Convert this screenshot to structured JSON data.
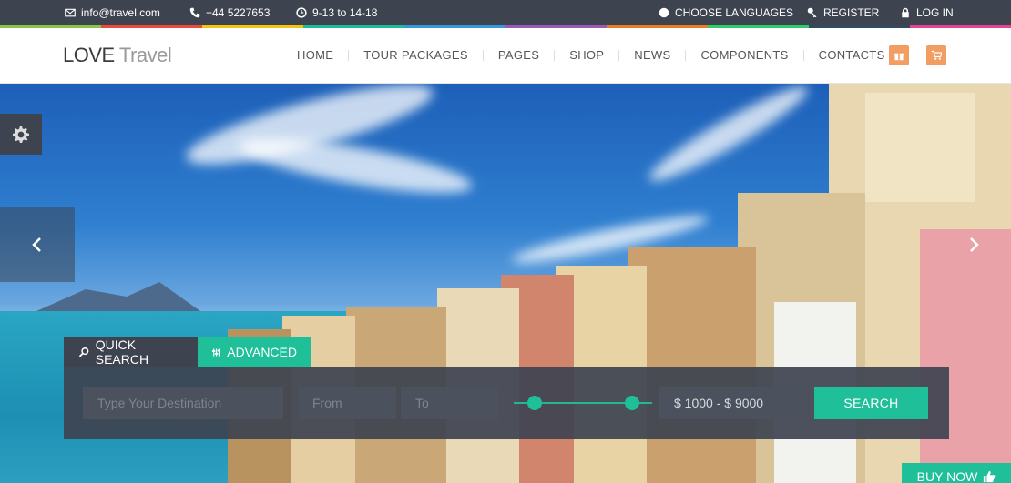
{
  "topbar": {
    "email": "info@travel.com",
    "phone": "+44 5227653",
    "hours": "9-13 to 14-18",
    "languages": "CHOOSE LANGUAGES",
    "register": "REGISTER",
    "login": "LOG IN"
  },
  "strip_colors": [
    "#8bc34a",
    "#e74c3c",
    "#f1c40f",
    "#1abc9c",
    "#3498db",
    "#9b59b6",
    "#e67e22",
    "#2ecc71",
    "#34495e",
    "#e84393"
  ],
  "logo": {
    "bold": "LOVE",
    "light": "Travel"
  },
  "nav": [
    "HOME",
    "TOUR PACKAGES",
    "PAGES",
    "SHOP",
    "NEWS",
    "COMPONENTS",
    "CONTACTS"
  ],
  "header_icons": [
    "gift-icon",
    "cart-icon"
  ],
  "accent": "#1fbf9a",
  "search": {
    "tab_quick": "QUICK SEARCH",
    "tab_advanced": "ADVANCED",
    "destination_placeholder": "Type Your Destination",
    "from_placeholder": "From",
    "to_placeholder": "To",
    "price_range": "$ 1000 - $ 9000",
    "button": "SEARCH"
  },
  "buy_now": "BUY NOW"
}
